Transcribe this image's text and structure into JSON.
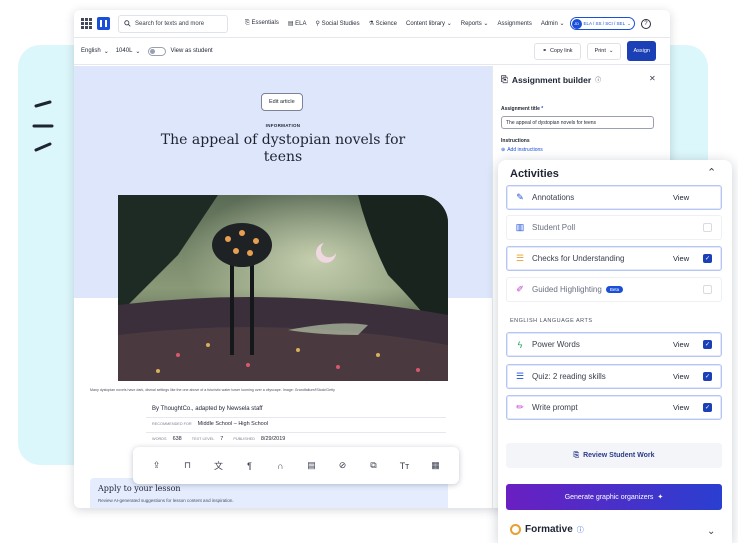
{
  "nav": {
    "search_placeholder": "Search for texts and more",
    "links": [
      "Essentials",
      "ELA",
      "Social Studies",
      "Science",
      "Content library",
      "Reports",
      "Assignments",
      "Admin"
    ],
    "account": "ELA / SS / SCI / SEL",
    "account_initials": "JD",
    "help": "?"
  },
  "toolbar": {
    "language": "English",
    "level": "1040L",
    "view_as_student": "View as student",
    "copy_link": "Copy link",
    "print": "Print",
    "assign": "Assign"
  },
  "article": {
    "edit": "Edit article",
    "kicker": "INFORMATION",
    "title": "The appeal of dystopian novels for teens",
    "caption": "Many dystopian novels have dark, dismal settings like the one above of a futuristic water tower looming over a cityscape. Image: Grandfailure/iStock/Getty",
    "byline": "By ThoughtCo., adapted by Newsela staff",
    "recommended_label": "RECOMMENDED FOR",
    "recommended_value": "Middle School – High School",
    "words_label": "WORDS",
    "words_value": "638",
    "text_level_label": "TEXT LEVEL",
    "text_level_value": "7",
    "published_label": "PUBLISHED",
    "published_value": "8/29/2019",
    "lesson_title": "Apply to your lesson",
    "lesson_text": "Review AI-generated suggestions for lesson content and inspiration."
  },
  "builder": {
    "title": "Assignment builder",
    "title_label": "Assignment title",
    "title_value": "The appeal of dystopian novels for teens",
    "instructions_label": "Instructions",
    "add_instructions": "Add instructions"
  },
  "activities": {
    "heading": "Activities",
    "section_label": "ENGLISH LANGUAGE ARTS",
    "view_label": "View",
    "beta": "Beta",
    "items": [
      {
        "label": "Annotations",
        "view": true,
        "checked": null
      },
      {
        "label": "Student Poll",
        "view": false,
        "checked": false
      },
      {
        "label": "Checks for Understanding",
        "view": true,
        "checked": true
      },
      {
        "label": "Guided Highlighting",
        "view": false,
        "checked": false
      },
      {
        "label": "Power Words",
        "view": true,
        "checked": true
      },
      {
        "label": "Quiz: 2 reading skills",
        "view": true,
        "checked": true
      },
      {
        "label": "Write prompt",
        "view": true,
        "checked": true
      }
    ],
    "review": "Review Student Work",
    "generate": "Generate graphic organizers",
    "formative": "Formative"
  },
  "colors": {
    "brand": "#1b4fd8",
    "assign": "#1b3fb5",
    "background_panel": "#dcf7fb",
    "hero": "#dde6fb"
  }
}
